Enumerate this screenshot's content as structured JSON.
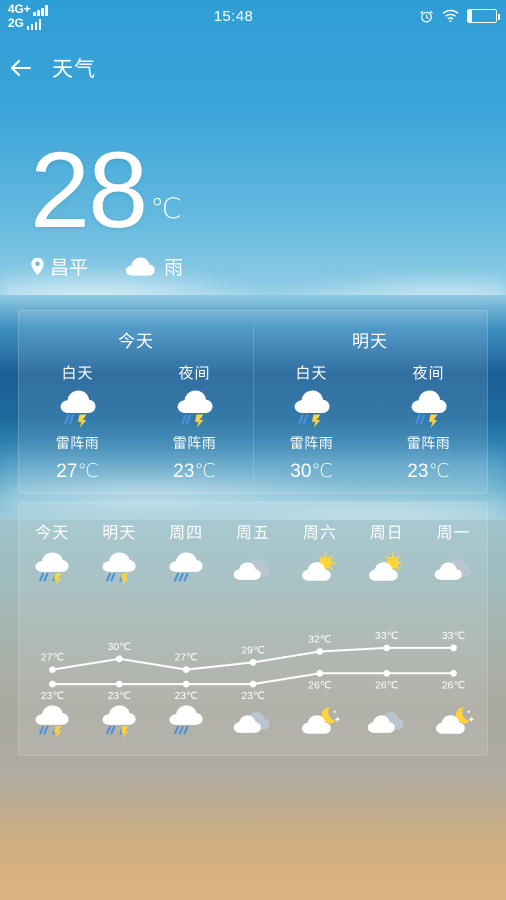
{
  "status_bar": {
    "sim1_label": "4G+",
    "sim2_label": "2G",
    "time": "15:48",
    "icons": [
      "alarm-clock-icon",
      "wifi-icon",
      "battery-icon"
    ],
    "battery_level": "14"
  },
  "app_bar": {
    "back_icon": "back-arrow-icon",
    "title": "天气"
  },
  "current": {
    "temperature": "28",
    "unit": "℃",
    "location_icon": "location-pin-icon",
    "city": "昌平",
    "condition_icon": "cloud-icon",
    "condition": "雨"
  },
  "today_tomorrow": [
    {
      "title": "今天",
      "periods": [
        {
          "label": "白天",
          "icon": "thunderstorm-icon",
          "condition": "雷阵雨",
          "temp": "27℃"
        },
        {
          "label": "夜间",
          "icon": "thunderstorm-icon",
          "condition": "雷阵雨",
          "temp": "23℃"
        }
      ]
    },
    {
      "title": "明天",
      "periods": [
        {
          "label": "白天",
          "icon": "thunderstorm-icon",
          "condition": "雷阵雨",
          "temp": "30℃"
        },
        {
          "label": "夜间",
          "icon": "thunderstorm-icon",
          "condition": "雷阵雨",
          "temp": "23℃"
        }
      ]
    }
  ],
  "week": {
    "days": [
      {
        "label": "今天",
        "day_icon": "thunderstorm-icon",
        "night_icon": "thunderstorm-night-icon"
      },
      {
        "label": "明天",
        "day_icon": "thunderstorm-icon",
        "night_icon": "thunderstorm-night-icon"
      },
      {
        "label": "周四",
        "day_icon": "rain-icon",
        "night_icon": "rain-night-icon"
      },
      {
        "label": "周五",
        "day_icon": "cloudy-icon",
        "night_icon": "cloudy-night-icon"
      },
      {
        "label": "周六",
        "day_icon": "partly-sunny-icon",
        "night_icon": "partly-moon-icon"
      },
      {
        "label": "周日",
        "day_icon": "partly-sunny-icon",
        "night_icon": "cloudy-night-icon"
      },
      {
        "label": "周一",
        "day_icon": "cloudy-icon",
        "night_icon": "partly-moon-icon"
      }
    ]
  },
  "colors": {
    "sky": "#2f9ed6",
    "sea": "#1b5f97",
    "sand": "#d6b27f",
    "text": "#ffffff",
    "lightning": "#ffd43b",
    "rain": "#4a90d9"
  },
  "chart_data": {
    "type": "line",
    "title": "",
    "xlabel": "",
    "ylabel": "",
    "categories": [
      "今天",
      "明天",
      "周四",
      "周五",
      "周六",
      "周日",
      "周一"
    ],
    "ylim": [
      20,
      36
    ],
    "grid": false,
    "legend": "none",
    "series": [
      {
        "name": "high",
        "values": [
          27,
          30,
          27,
          29,
          32,
          33,
          33
        ],
        "labels": [
          "27℃",
          "30℃",
          "27℃",
          "29℃",
          "32℃",
          "33℃",
          "33℃"
        ],
        "label_position": "above"
      },
      {
        "name": "low",
        "values": [
          23,
          23,
          23,
          23,
          26,
          26,
          26
        ],
        "labels": [
          "23℃",
          "23℃",
          "23℃",
          "23℃",
          "26℃",
          "26℃",
          "26℃"
        ],
        "label_position": "below"
      }
    ]
  }
}
